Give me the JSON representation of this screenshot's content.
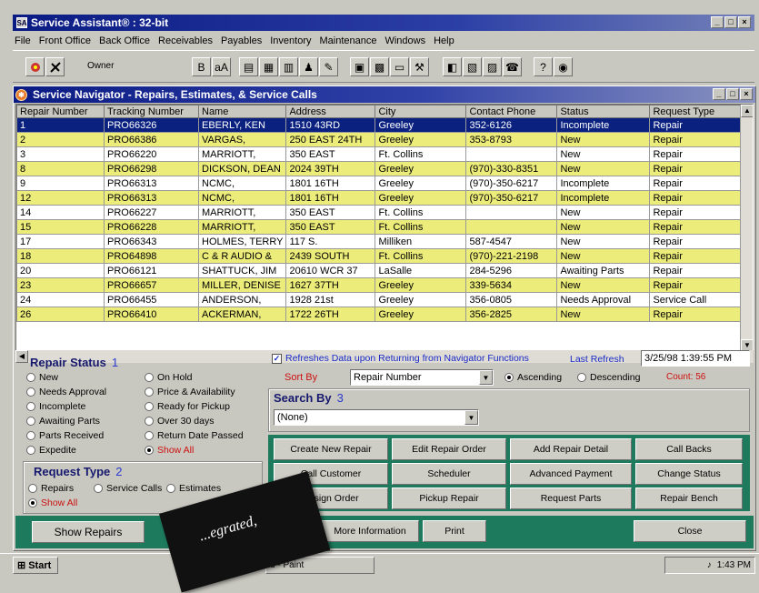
{
  "app": {
    "title": "Service Assistant® : 32-bit",
    "window_buttons": [
      "_",
      "□",
      "×"
    ]
  },
  "menu": [
    "File",
    "Front Office",
    "Back Office",
    "Receivables",
    "Payables",
    "Inventory",
    "Maintenance",
    "Windows",
    "Help"
  ],
  "toolbar": {
    "user": "Owner",
    "icons": [
      "owner-icon",
      "tools-icon",
      "bold-letter-icon",
      "aa-icon",
      "doc-icon",
      "doc2-icon",
      "chart-icon",
      "people-icon",
      "edit-icon",
      "image-icon",
      "grid-icon",
      "window-icon",
      "wrench-icon",
      "stack-icon",
      "clipboard-icon",
      "book-icon",
      "phone-icon",
      "question-icon",
      "circle-icon"
    ]
  },
  "navigator": {
    "title": "Service Navigator  -  Repairs, Estimates, & Service Calls",
    "columns": [
      "Repair Number",
      "Tracking Number",
      "Name",
      "Address",
      "City",
      "Contact Phone",
      "Status",
      "Request Type"
    ],
    "rows": [
      [
        "1",
        "PRO66326",
        "EBERLY, KEN",
        "1510 43RD",
        "Greeley",
        "352-6126",
        "Incomplete",
        "Repair"
      ],
      [
        "2",
        "PRO66386",
        "VARGAS,",
        "250 EAST 24TH",
        "Greeley",
        "353-8793",
        "New",
        "Repair"
      ],
      [
        "3",
        "PRO66220",
        "MARRIOTT,",
        "350 EAST",
        "Ft. Collins",
        "",
        "New",
        "Repair"
      ],
      [
        "8",
        "PRO66298",
        "DICKSON, DEAN",
        "2024 39TH",
        "Greeley",
        "(970)-330-8351",
        "New",
        "Repair"
      ],
      [
        "9",
        "PRO66313",
        "NCMC,",
        "1801 16TH",
        "Greeley",
        "(970)-350-6217",
        "Incomplete",
        "Repair"
      ],
      [
        "12",
        "PRO66313",
        "NCMC,",
        "1801 16TH",
        "Greeley",
        "(970)-350-6217",
        "Incomplete",
        "Repair"
      ],
      [
        "14",
        "PRO66227",
        "MARRIOTT,",
        "350 EAST",
        "Ft. Collins",
        "",
        "New",
        "Repair"
      ],
      [
        "15",
        "PRO66228",
        "MARRIOTT,",
        "350 EAST",
        "Ft. Collins",
        "",
        "New",
        "Repair"
      ],
      [
        "17",
        "PRO66343",
        "HOLMES, TERRY",
        "117 S.",
        "Milliken",
        "587-4547",
        "New",
        "Repair"
      ],
      [
        "18",
        "PRO64898",
        "C & R AUDIO &",
        "2439 SOUTH",
        "Ft. Collins",
        "(970)-221-2198",
        "New",
        "Repair"
      ],
      [
        "20",
        "PRO66121",
        "SHATTUCK, JIM",
        "20610 WCR 37",
        "LaSalle",
        "284-5296",
        "Awaiting Parts",
        "Repair"
      ],
      [
        "23",
        "PRO66657",
        "MILLER, DENISE",
        "1627 37TH",
        "Greeley",
        "339-5634",
        "New",
        "Repair"
      ],
      [
        "24",
        "PRO66455",
        "ANDERSON,",
        "1928 21st",
        "Greeley",
        "356-0805",
        "Needs Approval",
        "Service Call"
      ],
      [
        "26",
        "PRO66410",
        "ACKERMAN,",
        "1722 26TH",
        "Greeley",
        "356-2825",
        "New",
        "Repair"
      ]
    ],
    "row_styles": [
      "selected",
      "yellow",
      "white",
      "yellow",
      "white",
      "yellow",
      "white",
      "yellow",
      "white",
      "yellow",
      "white",
      "yellow",
      "white",
      "yellow"
    ]
  },
  "repair_status": {
    "title": "Repair Status",
    "number": "1",
    "options_left": [
      "New",
      "Needs Approval",
      "Incomplete",
      "Awaiting Parts",
      "Parts Received",
      "Expedite"
    ],
    "options_right": [
      "On Hold",
      "Price & Availability",
      "Ready for Pickup",
      "Over 30 days",
      "Return Date Passed",
      "Show All"
    ],
    "selected": "Show All"
  },
  "request_type": {
    "title": "Request Type",
    "number": "2",
    "options": [
      "Repairs",
      "Service Calls",
      "Estimates",
      "Show All"
    ],
    "selected": "Show All"
  },
  "refresh": {
    "checkbox_label": "Refreshes Data upon Returning from Navigator Functions",
    "checked": true,
    "last_refresh_label": "Last Refresh",
    "last_refresh_value": "3/25/98 1:39:55 PM"
  },
  "sort": {
    "label": "Sort By",
    "value": "Repair Number",
    "ascending_label": "Ascending",
    "descending_label": "Descending",
    "order": "Ascending",
    "count_label": "Count: 56"
  },
  "search": {
    "title": "Search By",
    "number": "3",
    "value": "(None)"
  },
  "actions": [
    [
      "Create New Repair",
      "Edit Repair Order",
      "Add Repair Detail",
      "Call Backs"
    ],
    [
      "Call Customer",
      "Scheduler",
      "Advanced Payment",
      "Change Status"
    ],
    [
      "Assign Order",
      "Pickup Repair",
      "Request Parts",
      "Repair Bench"
    ]
  ],
  "bottom": {
    "show_repairs": "Show Repairs",
    "more_information": "More Information",
    "print": "Print",
    "close": "Close"
  },
  "taskbar": {
    "start": "Start",
    "paint_task": "d - Paint",
    "clock": "1:43 PM"
  },
  "overlay": {
    "text": "...egrated,"
  },
  "colors": {
    "title_bar": "#0a1b84",
    "row_yellow": "#ecec7a",
    "selected_row": "#0a2180",
    "button_area": "#1d7a5d",
    "label_blue": "#16196e"
  }
}
